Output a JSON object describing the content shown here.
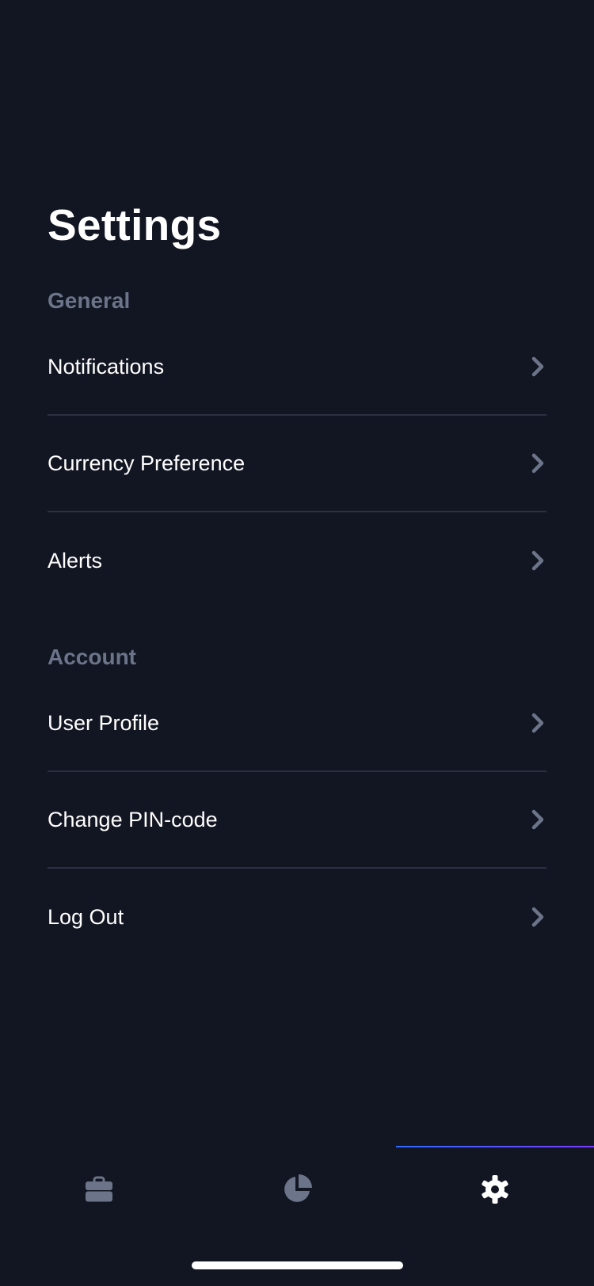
{
  "page": {
    "title": "Settings"
  },
  "sections": {
    "general": {
      "title": "General",
      "items": [
        {
          "label": "Notifications"
        },
        {
          "label": "Currency Preference"
        },
        {
          "label": "Alerts"
        }
      ]
    },
    "account": {
      "title": "Account",
      "items": [
        {
          "label": "User Profile"
        },
        {
          "label": "Change PIN-code"
        },
        {
          "label": "Log Out"
        }
      ]
    }
  },
  "tab_bar": {
    "tabs": [
      {
        "icon": "briefcase-icon",
        "active": false
      },
      {
        "icon": "pie-chart-icon",
        "active": false
      },
      {
        "icon": "gear-icon",
        "active": true
      }
    ]
  },
  "colors": {
    "background": "#121622",
    "text": "#ffffff",
    "section_text": "#6b7489",
    "inactive_icon": "#6b7489",
    "active_icon": "#ffffff",
    "divider": "#2a3041",
    "indicator_start": "#2f6bff",
    "indicator_end": "#7a3cff"
  }
}
